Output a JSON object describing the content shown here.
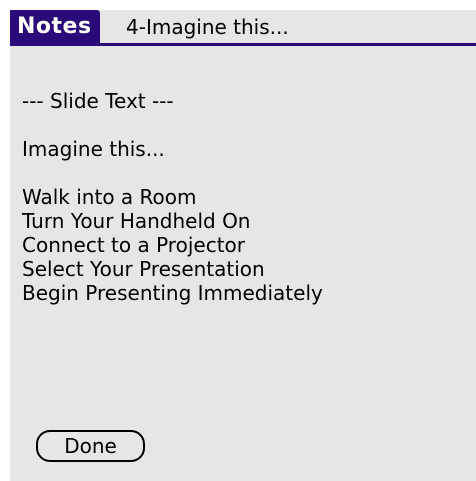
{
  "header": {
    "title_tab": "Notes",
    "title_text": "4-Imagine this..."
  },
  "note": {
    "heading": "--- Slide Text ---",
    "slide_title": "Imagine this...",
    "bullets": [
      "Walk into a Room",
      "Turn Your Handheld On",
      "Connect to a Projector",
      "Select Your Presentation",
      "Begin Presenting Immediately"
    ]
  },
  "actions": {
    "done_label": "Done"
  },
  "colors": {
    "titlebar": "#2a0a78",
    "background": "#e6e6e6",
    "text": "#000000"
  }
}
